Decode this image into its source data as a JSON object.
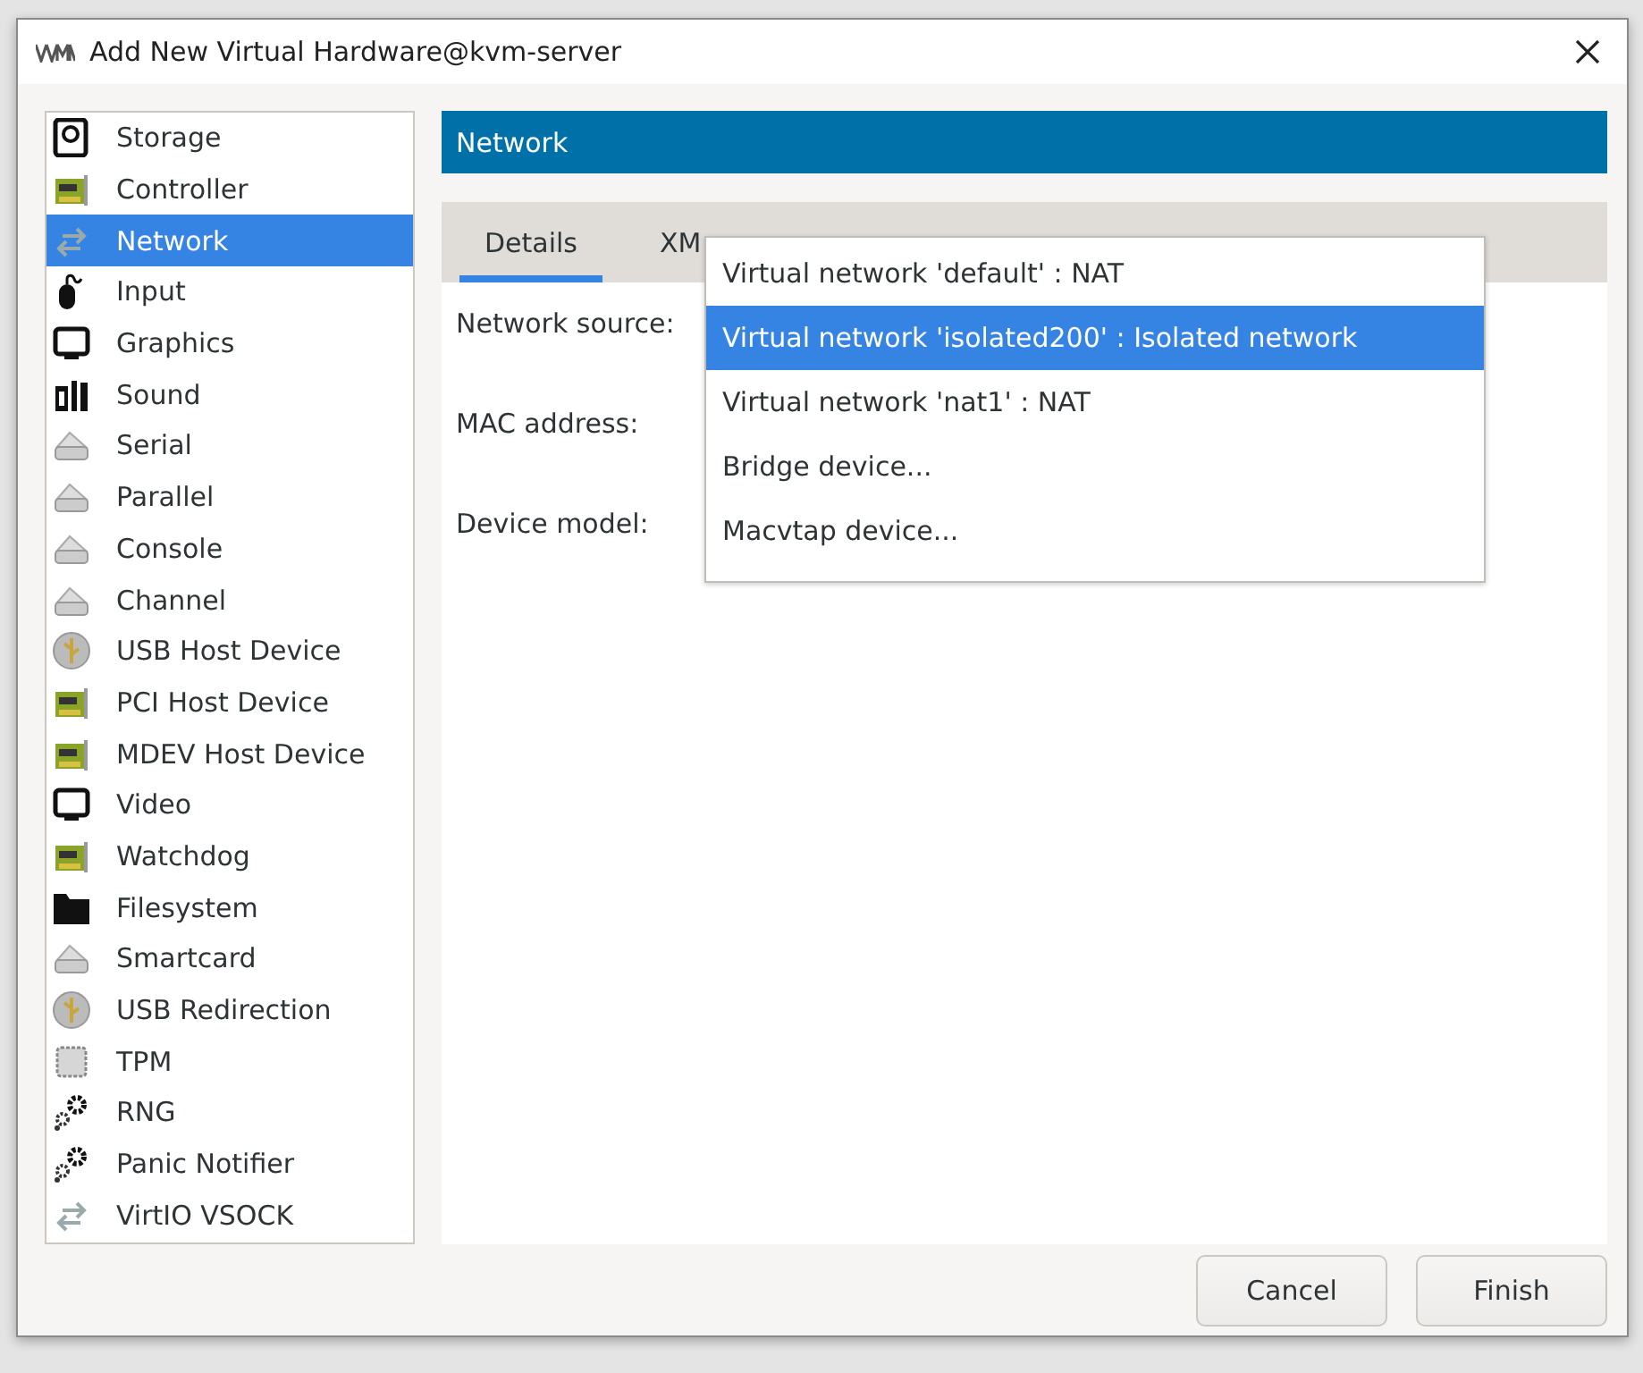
{
  "window": {
    "title": "Add New Virtual Hardware@kvm-server"
  },
  "sidebar": {
    "items": [
      {
        "label": "Storage",
        "kind": "disk",
        "selected": false
      },
      {
        "label": "Controller",
        "kind": "card",
        "selected": false
      },
      {
        "label": "Network",
        "kind": "arrows",
        "selected": true
      },
      {
        "label": "Input",
        "kind": "mouse",
        "selected": false
      },
      {
        "label": "Graphics",
        "kind": "monitor",
        "selected": false
      },
      {
        "label": "Sound",
        "kind": "sound",
        "selected": false
      },
      {
        "label": "Serial",
        "kind": "port",
        "selected": false
      },
      {
        "label": "Parallel",
        "kind": "port",
        "selected": false
      },
      {
        "label": "Console",
        "kind": "port",
        "selected": false
      },
      {
        "label": "Channel",
        "kind": "port",
        "selected": false
      },
      {
        "label": "USB Host Device",
        "kind": "usb",
        "selected": false
      },
      {
        "label": "PCI Host Device",
        "kind": "card",
        "selected": false
      },
      {
        "label": "MDEV Host Device",
        "kind": "card",
        "selected": false
      },
      {
        "label": "Video",
        "kind": "monitor",
        "selected": false
      },
      {
        "label": "Watchdog",
        "kind": "card",
        "selected": false
      },
      {
        "label": "Filesystem",
        "kind": "folder",
        "selected": false
      },
      {
        "label": "Smartcard",
        "kind": "port",
        "selected": false
      },
      {
        "label": "USB Redirection",
        "kind": "usb",
        "selected": false
      },
      {
        "label": "TPM",
        "kind": "chip",
        "selected": false
      },
      {
        "label": "RNG",
        "kind": "gears",
        "selected": false
      },
      {
        "label": "Panic Notifier",
        "kind": "gears",
        "selected": false
      },
      {
        "label": "VirtIO VSOCK",
        "kind": "arrows",
        "selected": false
      }
    ]
  },
  "panel": {
    "title": "Network",
    "tabs": [
      {
        "label": "Details",
        "selected": true
      },
      {
        "label": "XM",
        "selected": false
      }
    ],
    "fields": [
      "Network source:",
      "MAC address:",
      "Device model:"
    ],
    "dropdown": [
      {
        "label": "Virtual network 'default' : NAT",
        "selected": false
      },
      {
        "label": "Virtual network 'isolated200' : Isolated network",
        "selected": true
      },
      {
        "label": "Virtual network 'nat1' : NAT",
        "selected": false
      },
      {
        "label": "Bridge device...",
        "selected": false
      },
      {
        "label": "Macvtap device...",
        "selected": false
      }
    ]
  },
  "buttons": [
    "Cancel",
    "Finish"
  ]
}
